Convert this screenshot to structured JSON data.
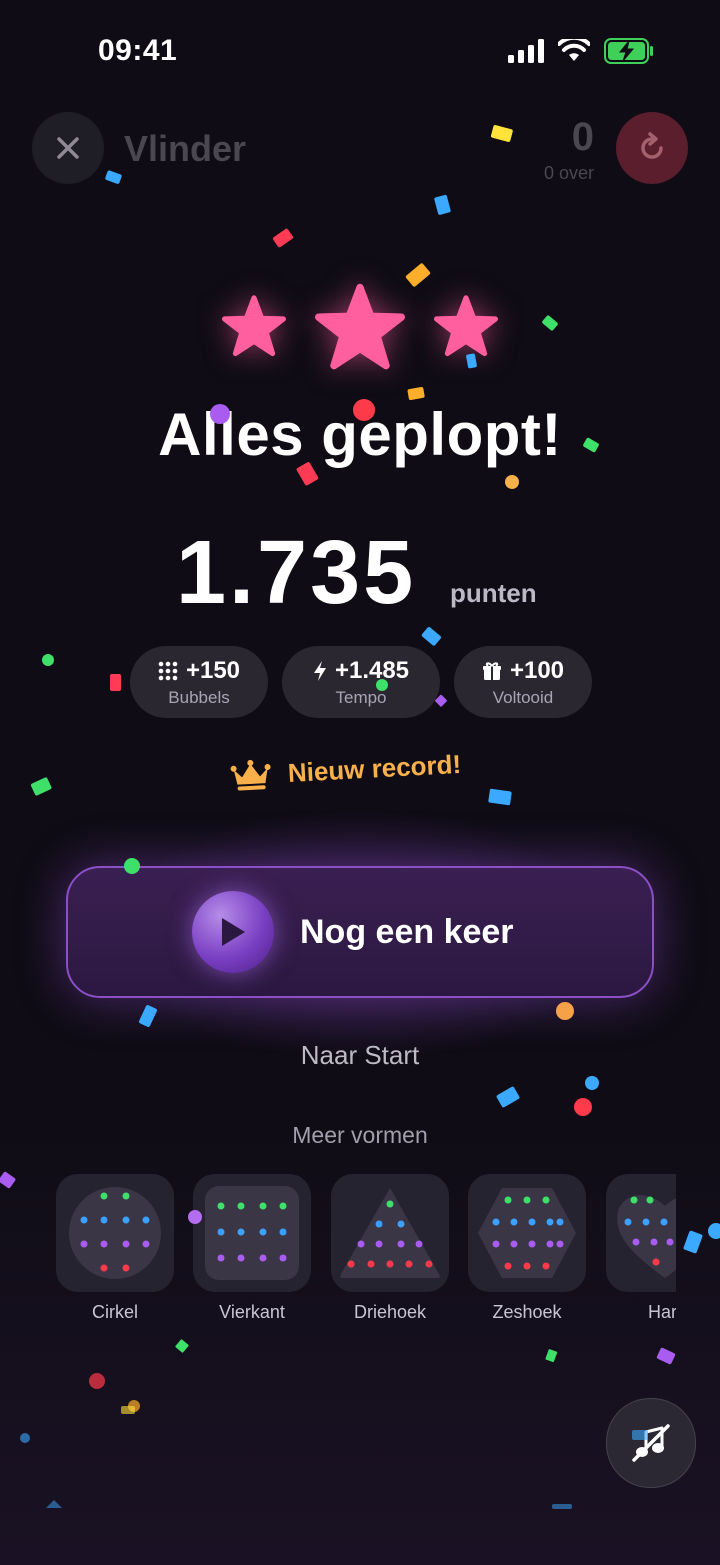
{
  "status_bar": {
    "time": "09:41"
  },
  "header": {
    "title": "Vlinder",
    "remaining_count": "0",
    "remaining_label": "0 over",
    "close_icon": "close-icon",
    "restart_icon": "restart-icon"
  },
  "result": {
    "stars_earned": 3,
    "stars_total": 3,
    "headline": "Alles geplopt!",
    "score": "1.735",
    "score_unit": "punten",
    "breakdown": [
      {
        "icon": "grid-icon",
        "value": "+150",
        "label": "Bubbels"
      },
      {
        "icon": "lightning-icon",
        "value": "+1.485",
        "label": "Tempo"
      },
      {
        "icon": "gift-icon",
        "value": "+100",
        "label": "Voltooid"
      }
    ],
    "record_text": "Nieuw record!",
    "record_icon": "crown-icon"
  },
  "actions": {
    "play_again_label": "Nog een keer",
    "home_label": "Naar Start"
  },
  "more_shapes": {
    "title": "Meer vormen",
    "items": [
      {
        "name": "Cirkel"
      },
      {
        "name": "Vierkant"
      },
      {
        "name": "Driehoek"
      },
      {
        "name": "Zeshoek"
      },
      {
        "name": "Hart"
      }
    ]
  },
  "sound": {
    "icon": "sound-off-icon",
    "muted": true
  },
  "colors": {
    "accent_purple": "#8b4fc6",
    "star_pink": "#ff5f9e",
    "record_orange": "#f7b04a",
    "background": "#0f0c15"
  }
}
